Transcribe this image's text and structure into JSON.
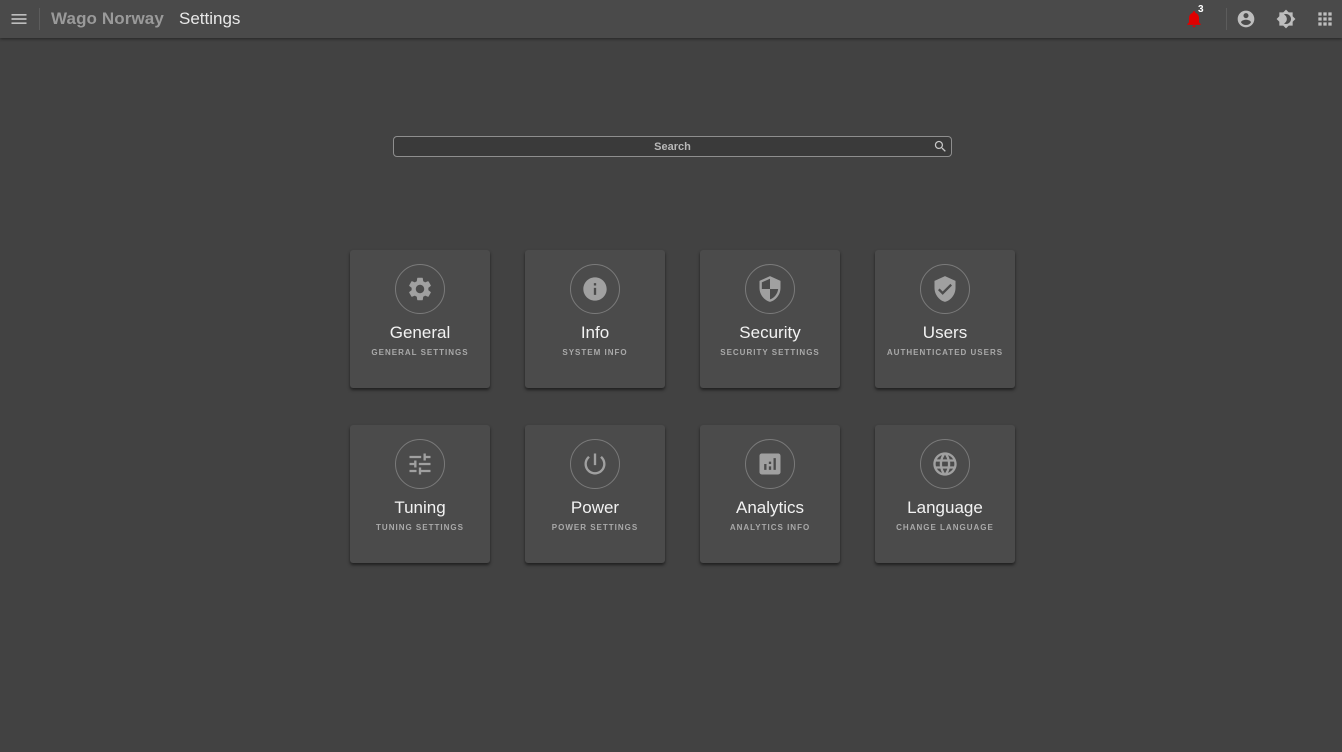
{
  "header": {
    "brand": "Wago Norway",
    "title": "Settings",
    "notification_count": "3",
    "notification_color": "#e00000"
  },
  "search": {
    "placeholder": "Search",
    "value": ""
  },
  "colors": {
    "background": "#424242",
    "topbar": "#4a4a4a",
    "tile": "#4b4b4b",
    "icon": "#a0a0a0"
  },
  "tiles": [
    {
      "title": "General",
      "subtitle": "GENERAL SETTINGS",
      "icon": "gear-icon"
    },
    {
      "title": "Info",
      "subtitle": "SYSTEM INFO",
      "icon": "info-icon"
    },
    {
      "title": "Security",
      "subtitle": "SECURITY SETTINGS",
      "icon": "shield-icon"
    },
    {
      "title": "Users",
      "subtitle": "AUTHENTICATED USERS",
      "icon": "verified-user-icon"
    },
    {
      "title": "Tuning",
      "subtitle": "TUNING SETTINGS",
      "icon": "tune-sliders-icon"
    },
    {
      "title": "Power",
      "subtitle": "POWER SETTINGS",
      "icon": "power-icon"
    },
    {
      "title": "Analytics",
      "subtitle": "ANALYTICS INFO",
      "icon": "analytics-icon"
    },
    {
      "title": "Language",
      "subtitle": "CHANGE LANGUAGE",
      "icon": "globe-icon"
    }
  ]
}
